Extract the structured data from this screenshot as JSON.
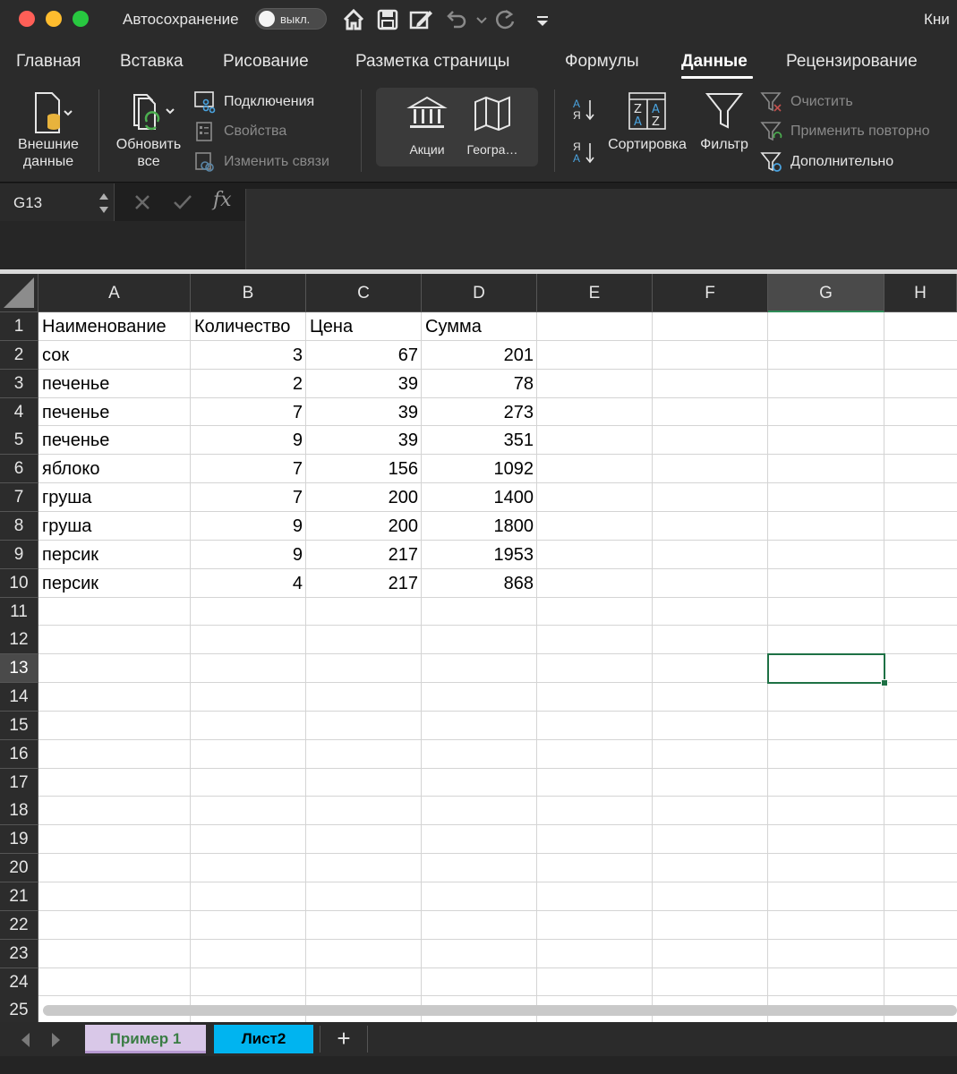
{
  "titlebar": {
    "autosave_label": "Автосохранение",
    "autosave_state": "выкл.",
    "doc_title": "Кни"
  },
  "tabs": [
    "Главная",
    "Вставка",
    "Рисование",
    "Разметка страницы",
    "Формулы",
    "Данные",
    "Рецензирование"
  ],
  "active_tab": "Данные",
  "ribbon": {
    "external_data": "Внешние данные",
    "refresh_all": "Обновить все",
    "connections": "Подключения",
    "properties": "Свойства",
    "edit_links": "Изменить связи",
    "stocks": "Акции",
    "geography": "Геогра…",
    "sort_az_top": "А",
    "sort_az_bottom": "Я",
    "sort_za_top": "Я",
    "sort_za_bottom": "А",
    "sort": "Сортировка",
    "filter": "Фильтр",
    "clear": "Очистить",
    "reapply": "Применить повторно",
    "advanced": "Дополнительно"
  },
  "formula_bar": {
    "name_box": "G13",
    "fx": "fx",
    "value": ""
  },
  "columns": [
    "A",
    "B",
    "C",
    "D",
    "E",
    "F",
    "G",
    "H"
  ],
  "selected_column": "G",
  "selected_row": 13,
  "rows": [
    "1",
    "2",
    "3",
    "4",
    "5",
    "6",
    "7",
    "8",
    "9",
    "10",
    "11",
    "12",
    "13",
    "14",
    "15",
    "16",
    "17",
    "18",
    "19",
    "20",
    "21",
    "22",
    "23",
    "24",
    "25"
  ],
  "table": {
    "headers": [
      "Наименование",
      "Количество",
      "Цена",
      "Сумма"
    ],
    "data": [
      [
        "сок",
        "3",
        "67",
        "201"
      ],
      [
        "печенье",
        "2",
        "39",
        "78"
      ],
      [
        "печенье",
        "7",
        "39",
        "273"
      ],
      [
        "печенье",
        "9",
        "39",
        "351"
      ],
      [
        "яблоко",
        "7",
        "156",
        "1092"
      ],
      [
        "груша",
        "7",
        "200",
        "1400"
      ],
      [
        "груша",
        "9",
        "200",
        "1800"
      ],
      [
        "персик",
        "9",
        "217",
        "1953"
      ],
      [
        "персик",
        "4",
        "217",
        "868"
      ]
    ]
  },
  "sheets": [
    "Пример 1",
    "Лист2"
  ],
  "add_sheet": "+",
  "colors": {
    "selection_green": "#1e7145",
    "sheet1_tab": "#d9c8e8",
    "sheet2_tab": "#00b4f0"
  }
}
